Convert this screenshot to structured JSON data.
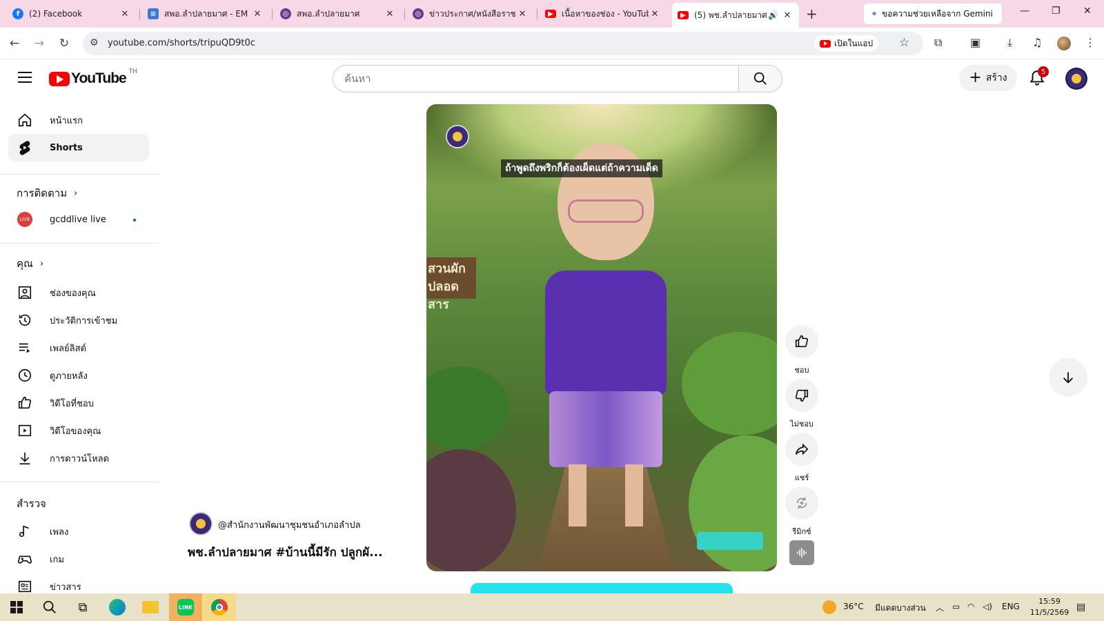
{
  "browser": {
    "tabs": [
      {
        "title": "(2) Facebook",
        "favicon": "facebook-icon",
        "color": "#1877f2"
      },
      {
        "title": "สพอ.ลำปลายมาศ - EM D",
        "favicon": "docs-icon",
        "color": "#3a7bd5"
      },
      {
        "title": "สพอ.ลำปลายมาศ",
        "favicon": "emblem-icon",
        "color": "#6a3a8a"
      },
      {
        "title": "ข่าวประกาศ/หนังสือราชกา",
        "favicon": "emblem-icon",
        "color": "#6a3a8a"
      },
      {
        "title": "เนื้อหาของช่อง - YouTube",
        "favicon": "youtube-icon",
        "color": "#ff0000"
      },
      {
        "title": "(5) พช.ลำปลายมาศ #",
        "favicon": "youtube-icon",
        "color": "#ff0000",
        "active": true
      }
    ],
    "gemini_label": "ขอความช่วยเหลือจาก Gemini",
    "url": "youtube.com/shorts/tripuQD9t0c",
    "open_in_app": "เปิดในแอป"
  },
  "header": {
    "logo_text": "YouTube",
    "country": "TH",
    "search_placeholder": "ค้นหา",
    "create_label": "สร้าง",
    "notification_count": "5"
  },
  "sidebar": {
    "main": [
      {
        "label": "หน้าแรก",
        "icon": "home-icon"
      },
      {
        "label": "Shorts",
        "icon": "shorts-icon",
        "active": true
      }
    ],
    "subscriptions_title": "การติดตาม",
    "subscriptions": [
      {
        "label": "gcddlive live",
        "icon": "channel-avatar"
      }
    ],
    "you_title": "คุณ",
    "you": [
      {
        "label": "ช่องของคุณ",
        "icon": "your-channel-icon"
      },
      {
        "label": "ประวัติการเข้าชม",
        "icon": "history-icon"
      },
      {
        "label": "เพลย์ลิสต์",
        "icon": "playlist-icon"
      },
      {
        "label": "ดูภายหลัง",
        "icon": "watch-later-icon"
      },
      {
        "label": "วิดีโอที่ชอบ",
        "icon": "liked-icon"
      },
      {
        "label": "วิดีโอของคุณ",
        "icon": "your-videos-icon"
      },
      {
        "label": "การดาวน์โหลด",
        "icon": "download-icon"
      }
    ],
    "explore_title": "สำรวจ",
    "explore": [
      {
        "label": "เพลง",
        "icon": "music-icon"
      },
      {
        "label": "เกม",
        "icon": "gaming-icon"
      },
      {
        "label": "ข่าวสาร",
        "icon": "news-icon"
      }
    ]
  },
  "video": {
    "caption": "ถ้าพูดถึงพริกก็ต้องเผ็ดแต่ถ้าความเด็ด",
    "sign_text": "สวนผัก ปลอดสาร",
    "channel": "@สำนักงานพัฒนาชุมชนอำเภอลำปล",
    "title": "พช.ลำปลายมาศ #บ้านนี้มีรัก ปลูกผั..."
  },
  "actions": {
    "like": "ชอบ",
    "dislike": "ไม่ชอบ",
    "share": "แชร์",
    "remix": "รีมิกซ์"
  },
  "taskbar": {
    "weather_temp": "36°C",
    "weather_text": "มีแดดบางส่วน",
    "lang": "ENG",
    "time": "15:59",
    "date": "11/5/2569"
  }
}
